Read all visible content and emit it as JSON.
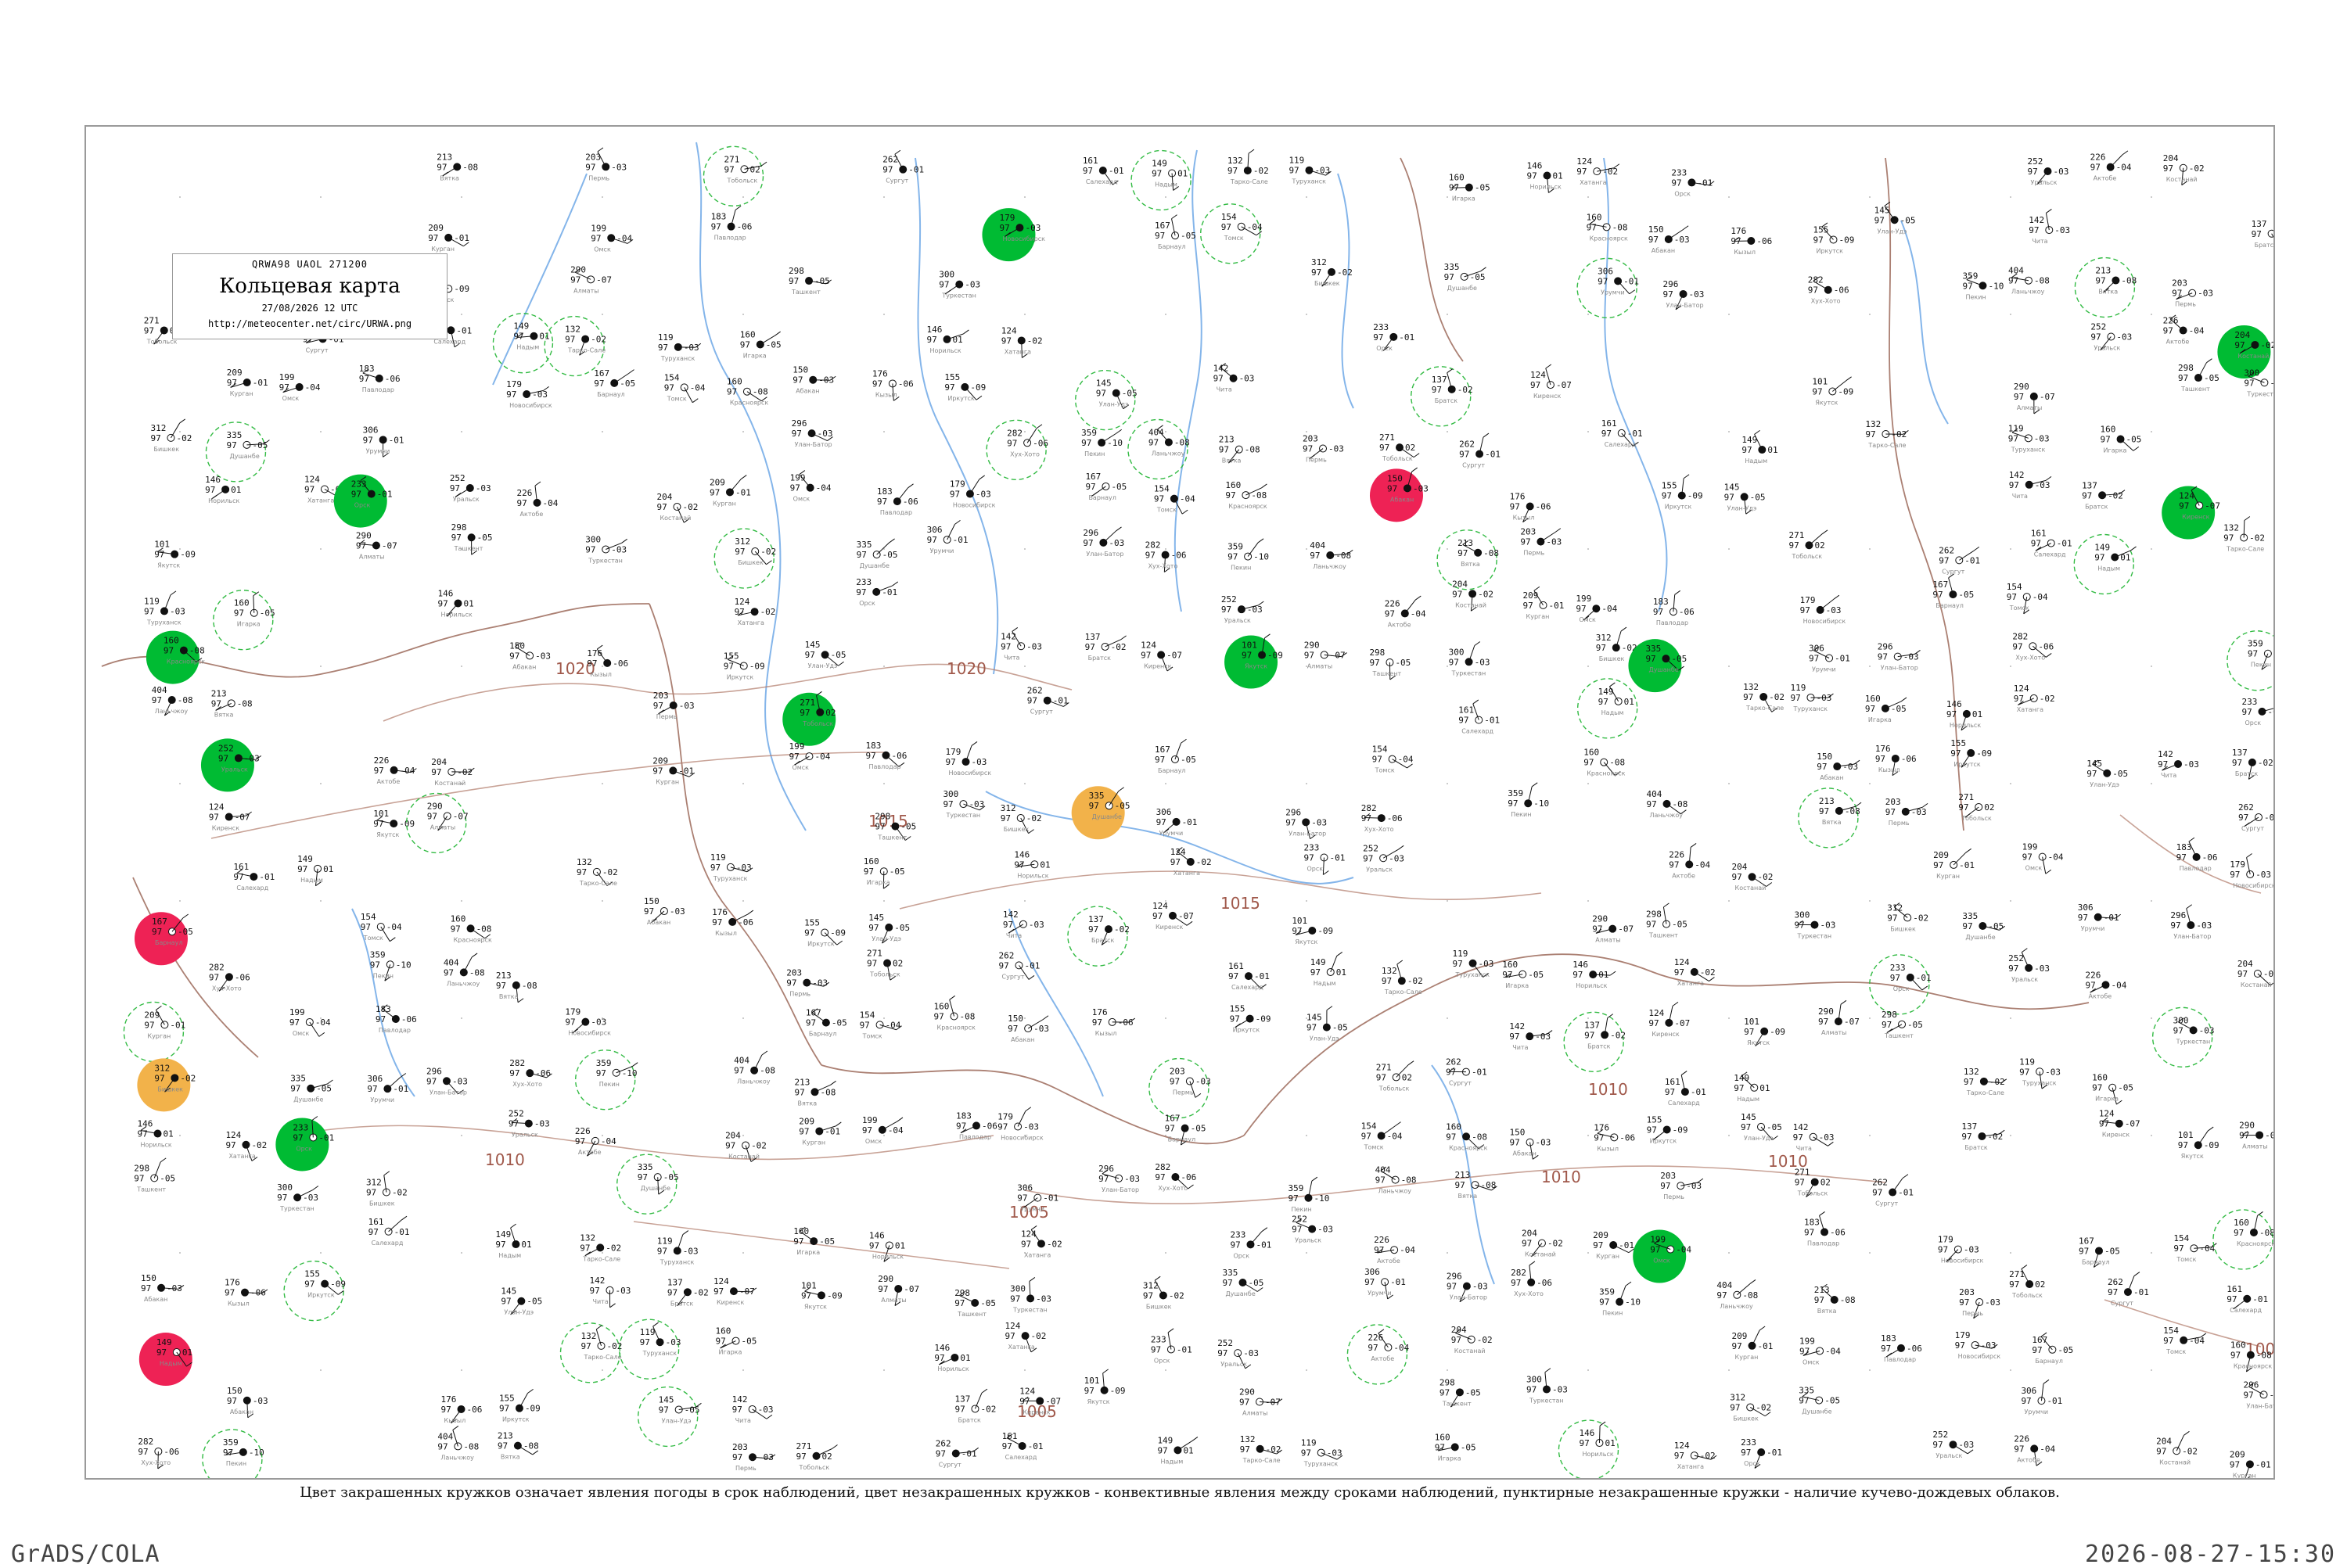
{
  "title_box": {
    "code": "QRWA98  UAOL  271200",
    "title": "Кольцевая карта",
    "date": "27/08/2026 12 UTC",
    "url": "http://meteocenter.net/circ/URWA.png"
  },
  "legend_text": "Цвет закрашенных кружков означает явления погоды в срок наблюдений, цвет незакрашенных кружков - конвективные явления между сроками наблюдений, пунктирные незакрашенные кружки - наличие кучево-дождевых облаков.",
  "footer": {
    "left": "GrADS/COLA",
    "right": "2026-08-27-15:30"
  },
  "colors": {
    "river": "#6ea8e6",
    "border": "#9c6a5a",
    "isobar": "#b07a6a",
    "rain_fill": "#00bb33",
    "thunder_fill": "#ee2255",
    "fog_fill": "#f0f000",
    "dust_fill": "#f2b24a",
    "shower_fill": "#2a88f0",
    "cb_ring": "#33bb44",
    "ts_ring": "#ee3355"
  },
  "isobar_labels": [
    "1020",
    "1020",
    "1015",
    "1015",
    "1010",
    "1010",
    "1010",
    "1010",
    "1005",
    "1005",
    "100"
  ],
  "stations": [
    {
      "t": "213",
      "p": "97",
      "d": "-08",
      "name": "Вятка"
    },
    {
      "t": "203",
      "p": "97",
      "d": "-03",
      "name": "Пермь"
    },
    {
      "t": "271",
      "p": "97",
      "d": "02",
      "name": "Тобольск"
    },
    {
      "t": "262",
      "p": "97",
      "d": "-01",
      "name": "Сургут"
    },
    {
      "t": "161",
      "p": "97",
      "d": "-01",
      "name": "Салехард"
    },
    {
      "t": "149",
      "p": "97",
      "d": "01",
      "name": "Надым"
    },
    {
      "t": "132",
      "p": "97",
      "d": "-02",
      "name": "Тарко-Сале"
    },
    {
      "t": "119",
      "p": "97",
      "d": "-03",
      "name": "Туруханск"
    },
    {
      "t": "160",
      "p": "97",
      "d": "-05",
      "name": "Игарка"
    },
    {
      "t": "146",
      "p": "97",
      "d": "01",
      "name": "Норильск"
    },
    {
      "t": "124",
      "p": "97",
      "d": "-02",
      "name": "Хатанга"
    },
    {
      "t": "233",
      "p": "97",
      "d": "-01",
      "name": "Орск"
    },
    {
      "t": "252",
      "p": "97",
      "d": "-03",
      "name": "Уральск"
    },
    {
      "t": "226",
      "p": "97",
      "d": "-04",
      "name": "Актобе"
    },
    {
      "t": "204",
      "p": "97",
      "d": "-02",
      "name": "Костанай"
    },
    {
      "t": "209",
      "p": "97",
      "d": "-01",
      "name": "Курган"
    },
    {
      "t": "199",
      "p": "97",
      "d": "-04",
      "name": "Омск"
    },
    {
      "t": "183",
      "p": "97",
      "d": "-06",
      "name": "Павлодар"
    },
    {
      "t": "179",
      "p": "97",
      "d": "-03",
      "name": "Новосибирск"
    },
    {
      "t": "167",
      "p": "97",
      "d": "-05",
      "name": "Барнаул"
    },
    {
      "t": "154",
      "p": "97",
      "d": "-04",
      "name": "Томск"
    },
    {
      "t": "160",
      "p": "97",
      "d": "-08",
      "name": "Красноярск"
    },
    {
      "t": "150",
      "p": "97",
      "d": "-03",
      "name": "Абакан"
    },
    {
      "t": "176",
      "p": "97",
      "d": "-06",
      "name": "Кызыл"
    },
    {
      "t": "155",
      "p": "97",
      "d": "-09",
      "name": "Иркутск"
    },
    {
      "t": "145",
      "p": "97",
      "d": "-05",
      "name": "Улан-Удэ"
    },
    {
      "t": "142",
      "p": "97",
      "d": "-03",
      "name": "Чита"
    },
    {
      "t": "137",
      "p": "97",
      "d": "-02",
      "name": "Братск"
    },
    {
      "t": "124",
      "p": "97",
      "d": "-07",
      "name": "Киренск"
    },
    {
      "t": "101",
      "p": "97",
      "d": "-09",
      "name": "Якутск"
    },
    {
      "t": "290",
      "p": "97",
      "d": "-07",
      "name": "Алматы"
    },
    {
      "t": "298",
      "p": "97",
      "d": "-05",
      "name": "Ташкент"
    },
    {
      "t": "300",
      "p": "97",
      "d": "-03",
      "name": "Туркестан"
    },
    {
      "t": "312",
      "p": "97",
      "d": "-02",
      "name": "Бишкек"
    },
    {
      "t": "335",
      "p": "97",
      "d": "-05",
      "name": "Душанбе"
    },
    {
      "t": "306",
      "p": "97",
      "d": "-01",
      "name": "Урумчи"
    },
    {
      "t": "296",
      "p": "97",
      "d": "-03",
      "name": "Улан-Батор"
    },
    {
      "t": "282",
      "p": "97",
      "d": "-06",
      "name": "Хух-Хото"
    },
    {
      "t": "359",
      "p": "97",
      "d": "-10",
      "name": "Пекин"
    },
    {
      "t": "404",
      "p": "97",
      "d": "-08",
      "name": "Ланьчжоу"
    }
  ]
}
